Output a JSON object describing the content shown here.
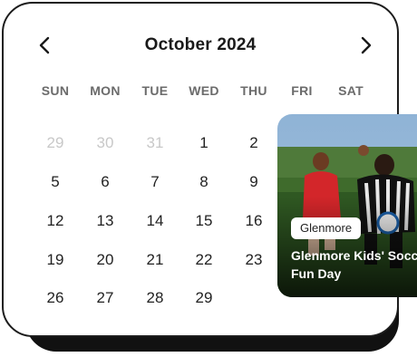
{
  "calendar": {
    "month_label": "October 2024",
    "weekdays": [
      "SUN",
      "MON",
      "TUE",
      "WED",
      "THU",
      "FRI",
      "SAT"
    ],
    "weeks": [
      [
        {
          "d": "29",
          "muted": true
        },
        {
          "d": "30",
          "muted": true
        },
        {
          "d": "31",
          "muted": true
        },
        {
          "d": "1"
        },
        {
          "d": "2"
        }
      ],
      [
        {
          "d": "5"
        },
        {
          "d": "6"
        },
        {
          "d": "7"
        },
        {
          "d": "8"
        },
        {
          "d": "9"
        }
      ],
      [
        {
          "d": "12"
        },
        {
          "d": "13"
        },
        {
          "d": "14"
        },
        {
          "d": "15"
        },
        {
          "d": "16"
        }
      ],
      [
        {
          "d": "19"
        },
        {
          "d": "20"
        },
        {
          "d": "21"
        },
        {
          "d": "22"
        },
        {
          "d": "23"
        }
      ],
      [
        {
          "d": "26"
        },
        {
          "d": "27"
        },
        {
          "d": "28"
        },
        {
          "d": "29"
        }
      ]
    ],
    "prev_icon": "chevron-left-icon",
    "next_icon": "chevron-right-icon"
  },
  "event": {
    "tag": "Glenmore",
    "title_line1": "Glenmore Kids' Soccer",
    "title_line2": "Fun Day"
  },
  "colors": {
    "text": "#1a1a1a",
    "muted": "#c8c8c8",
    "weekday": "#6b6b6b",
    "card_border": "#1c1c1c"
  }
}
